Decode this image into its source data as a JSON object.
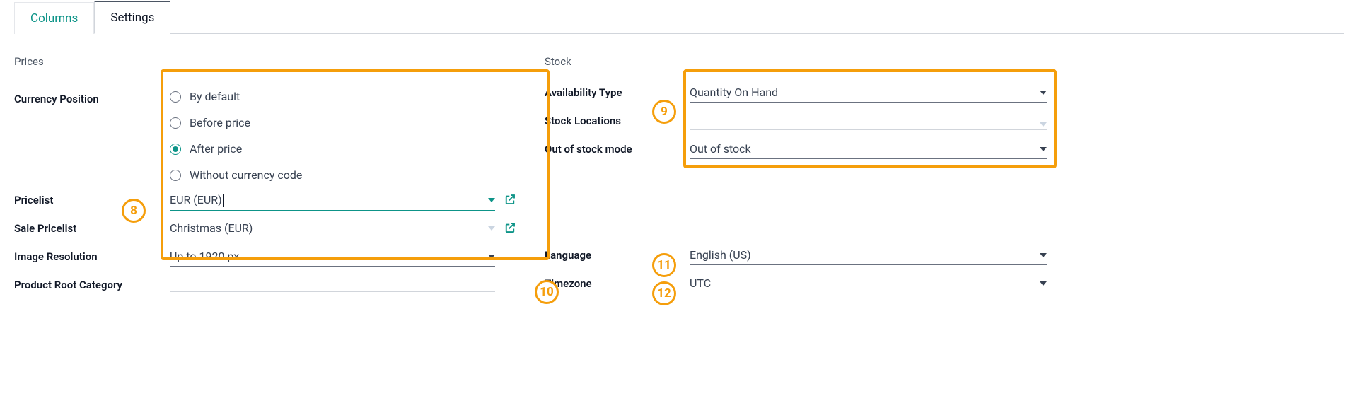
{
  "tabs": {
    "columns": "Columns",
    "settings": "Settings"
  },
  "left": {
    "section": "Prices",
    "currency_position_label": "Currency Position",
    "currency_options": {
      "by_default": "By default",
      "before": "Before price",
      "after": "After price",
      "without": "Without currency code"
    },
    "pricelist_label": "Pricelist",
    "pricelist_value": "EUR (EUR)",
    "sale_pricelist_label": "Sale Pricelist",
    "sale_pricelist_value": "Christmas (EUR)",
    "image_resolution_label": "Image Resolution",
    "image_resolution_value": "Up to 1920 px",
    "product_root_label": "Product Root Category"
  },
  "right": {
    "section": "Stock",
    "availability_label": "Availability Type",
    "availability_value": "Quantity On Hand",
    "stock_locations_label": "Stock Locations",
    "out_of_stock_label": "Out of stock mode",
    "out_of_stock_value": "Out of stock",
    "language_label": "Language",
    "language_value": "English (US)",
    "timezone_label": "Timezone",
    "timezone_value": "UTC"
  },
  "annotations": {
    "a8": "8",
    "a9": "9",
    "a10": "10",
    "a11": "11",
    "a12": "12"
  }
}
